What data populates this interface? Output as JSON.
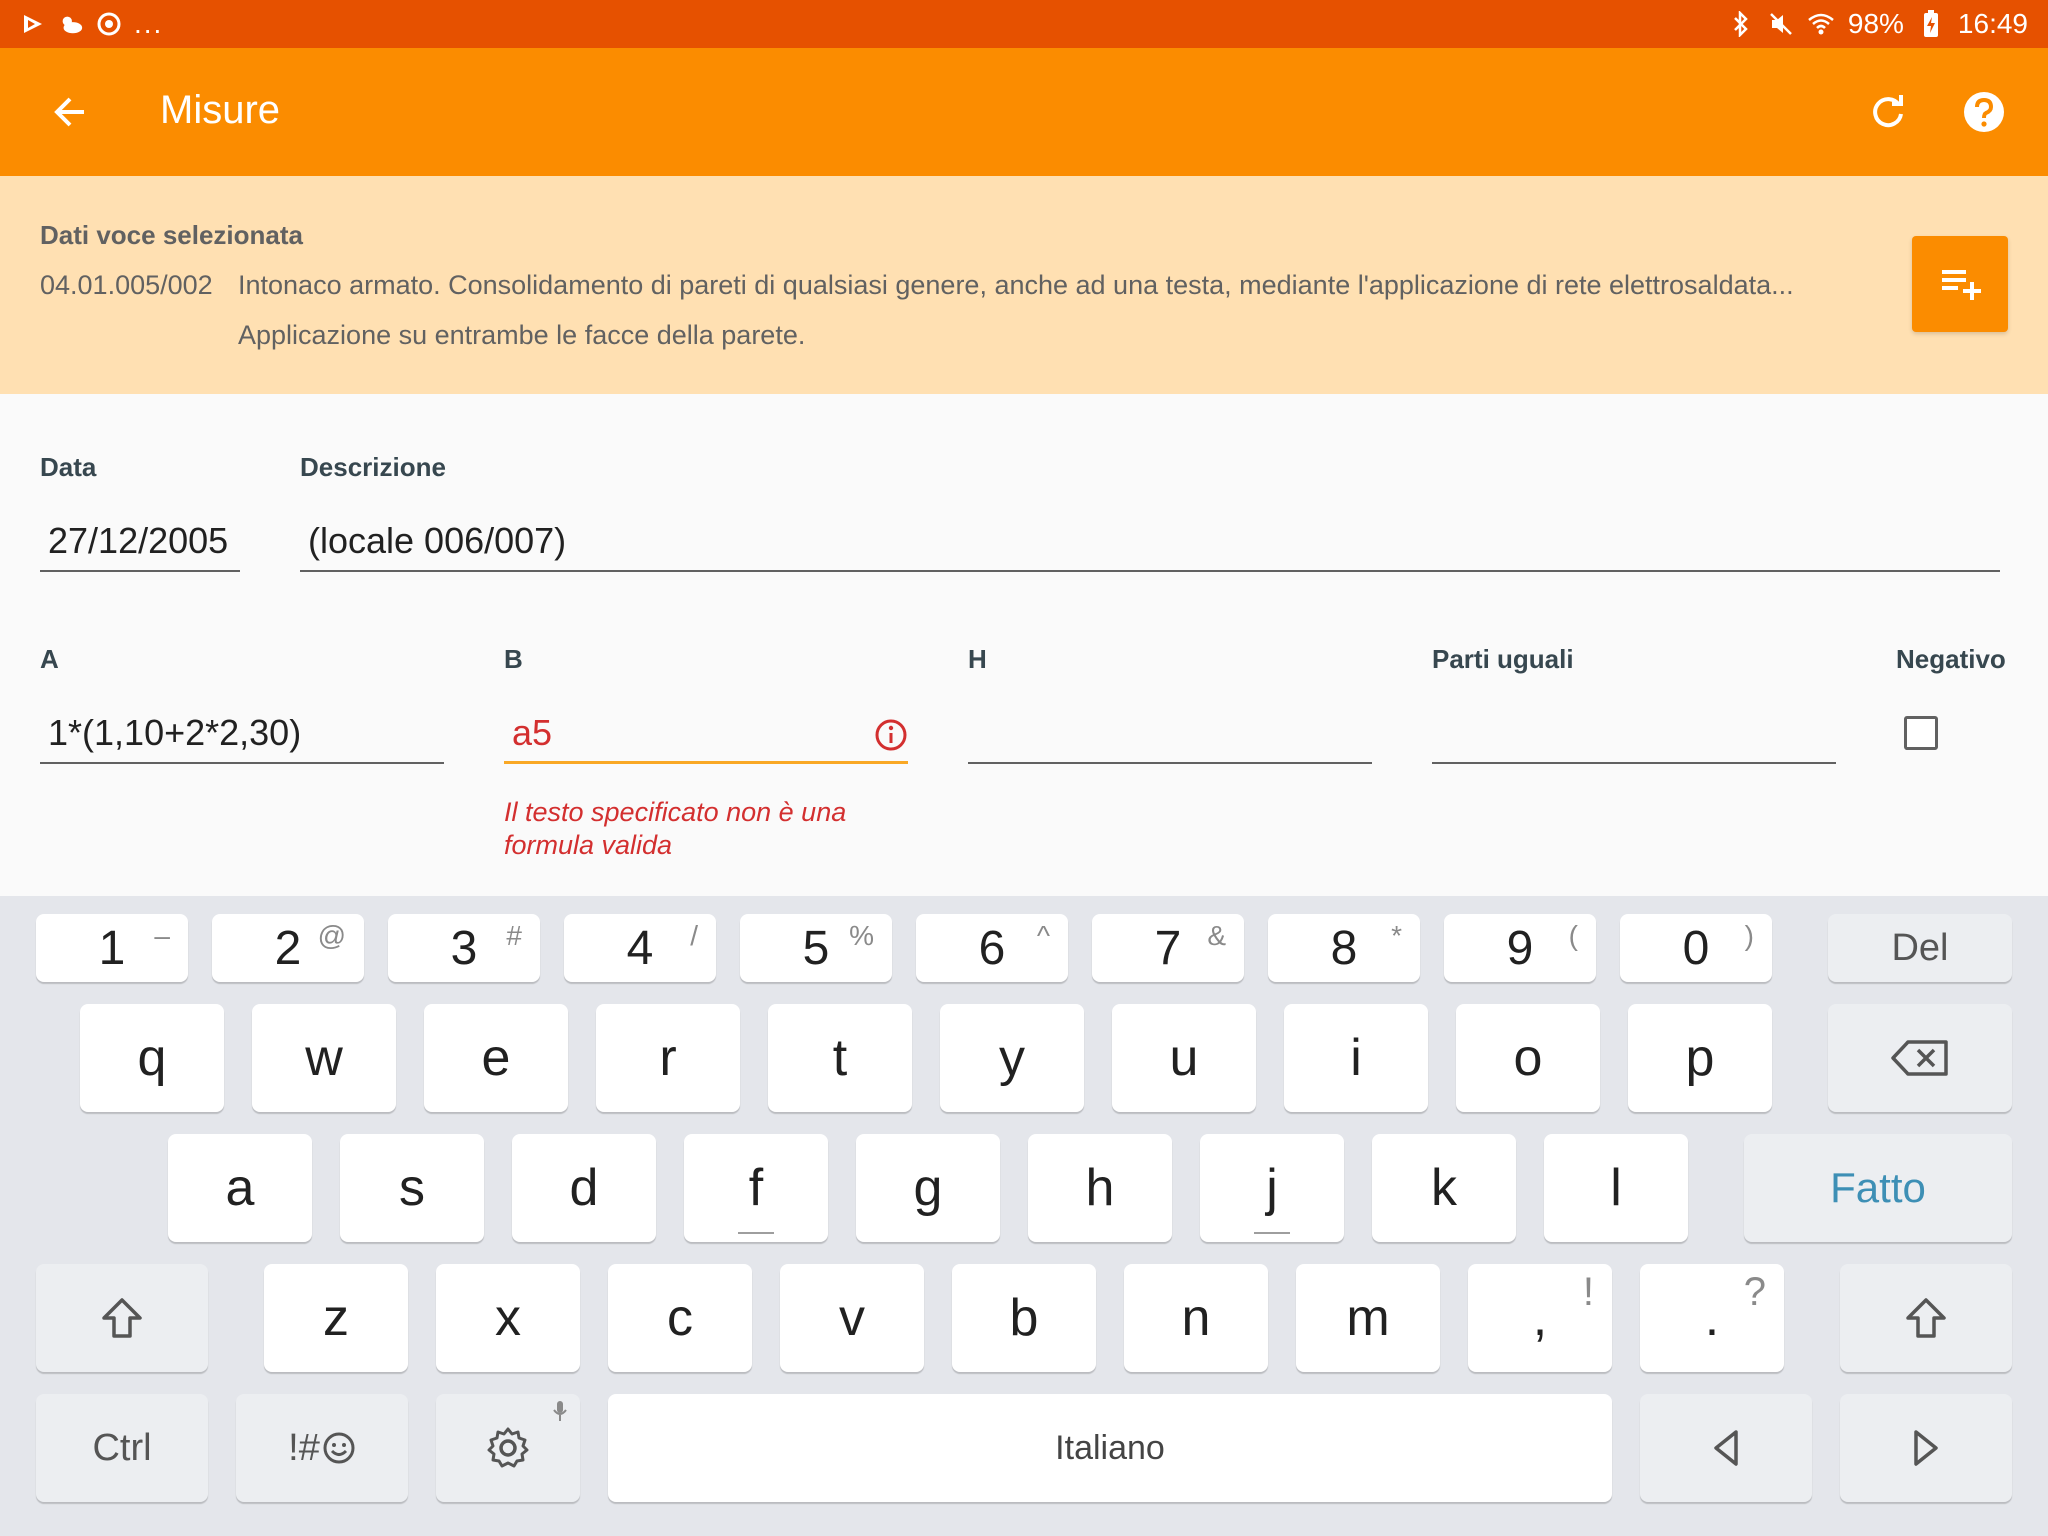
{
  "status_bar": {
    "battery": "98%",
    "time": "16:49",
    "overflow": "..."
  },
  "app_bar": {
    "title": "Misure"
  },
  "selected_item": {
    "heading": "Dati voce selezionata",
    "code": "04.01.005/002",
    "description_line1": "Intonaco armato. Consolidamento di pareti di qualsiasi genere, anche ad una testa, mediante l'applicazione di rete elettrosaldata...",
    "description_line2": "Applicazione su entrambe le facce della parete."
  },
  "form": {
    "data_label": "Data",
    "data_value": "27/12/2005",
    "descrizione_label": "Descrizione",
    "descrizione_value": "(locale 006/007)",
    "a_label": "A",
    "a_value": "1*(1,10+2*2,30)",
    "b_label": "B",
    "b_value": "a5",
    "b_error": "Il testo specificato non è una formula valida",
    "h_label": "H",
    "h_value": "",
    "parti_label": "Parti uguali",
    "parti_value": "",
    "negativo_label": "Negativo",
    "negativo_checked": false
  },
  "keyboard": {
    "number_row": [
      {
        "main": "1",
        "sub": "–"
      },
      {
        "main": "2",
        "sub": "@"
      },
      {
        "main": "3",
        "sub": "#"
      },
      {
        "main": "4",
        "sub": "/"
      },
      {
        "main": "5",
        "sub": "%"
      },
      {
        "main": "6",
        "sub": "^"
      },
      {
        "main": "7",
        "sub": "&"
      },
      {
        "main": "8",
        "sub": "*"
      },
      {
        "main": "9",
        "sub": "("
      },
      {
        "main": "0",
        "sub": ")"
      }
    ],
    "del_label": "Del",
    "row_q": [
      "q",
      "w",
      "e",
      "r",
      "t",
      "y",
      "u",
      "i",
      "o",
      "p"
    ],
    "row_a": [
      "a",
      "s",
      "d",
      "f",
      "g",
      "h",
      "j",
      "k",
      "l"
    ],
    "done_label": "Fatto",
    "row_z": [
      "z",
      "x",
      "c",
      "v",
      "b",
      "n",
      "m"
    ],
    "comma": {
      "main": ",",
      "sub": "!"
    },
    "period": {
      "main": ".",
      "sub": "?"
    },
    "ctrl_label": "Ctrl",
    "symbols_label": "!#",
    "space_label": "Italiano"
  },
  "colors": {
    "status_bar": "#e65100",
    "app_bar": "#fb8c00",
    "info_panel": "#ffe0b2",
    "error": "#d32f2f",
    "error_underline": "#f9a825",
    "done_key_text": "#3d8fb5"
  }
}
